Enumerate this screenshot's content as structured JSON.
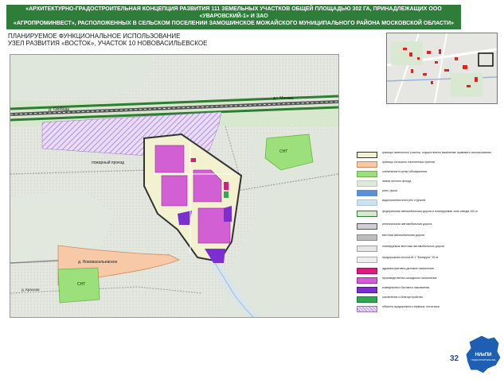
{
  "header": {
    "title": "«АРХИТЕКТУРНО-ГРАДОСТРОИТЕЛЬНАЯ КОНЦЕПЦИЯ РАЗВИТИЯ 111 ЗЕМЕЛЬНЫХ УЧАСТКОВ ОБЩЕЙ ПЛОЩАДЬЮ 302 ГА, ПРИНАДЛЕЖАЩИХ ООО «УВАРОВСКИЙ-1» И ЗАО\n«АГРОПРОМИНВЕСТ», РАСПОЛОЖЕННЫХ В СЕЛЬСКОМ ПОСЕЛЕНИИ ЗАМОШИНСКОЕ МОЖАЙСКОГО МУНИЦИПАЛЬНОГО РАЙОНА МОСКОВСКОЙ ОБЛАСТИ»"
  },
  "subtitle": "ПЛАНИРУЕМОЕ ФУНКЦИОНАЛЬНОЕ ИСПОЛЬЗОВАНИЕ\nУЗЕЛ РАЗВИТИЯ «ВОСТОК», УЧАСТОК 10 НОВОВАСИЛЬЕВСКОЕ",
  "map": {
    "labels": {
      "svoboda": "д. Свобода",
      "moscow": "д.г. Москва",
      "proezd": "пожарный проезд",
      "novovasilyevskoe": "д. Нововасильевское",
      "snt_east": "СНТ",
      "snt_west": "СНТ",
      "krasnaya": "д. Красная"
    }
  },
  "legend": [
    {
      "label": "границы земельного участка, осуществлено изменение правового использования",
      "color": "#f2f2d0",
      "border": "#333333"
    },
    {
      "label": "границы сельского населенных пунктов",
      "color": "#f7c9a6",
      "border": "#d08a55"
    },
    {
      "label": "озеленение в целях объединения",
      "color": "#9be07a",
      "border": "#6bb34a"
    },
    {
      "label": "земли лесного фонда",
      "color": "#dde9dd",
      "border": "#b9cbb9"
    },
    {
      "label": "реки, ручьи",
      "color": "#5a8fd6",
      "border": "#5a8fd6"
    },
    {
      "label": "водоохранная зона рек и ручьев",
      "color": "#cfe0f3",
      "border": "#a9c4e6"
    },
    {
      "label": "федеральная автомобильная дорога и планируемая зона отвода 100 м",
      "color": "#d8e8cf",
      "border": "#2e7d32"
    },
    {
      "label": "региональная автомобильная дорога",
      "color": "#cfcfcf",
      "border": "#555555"
    },
    {
      "label": "местная автомобильная дорога",
      "color": "#bdbdbd",
      "border": "#888888"
    },
    {
      "label": "планируемые местные автомобильные дороги",
      "color": "#e6e6e6",
      "border": "#9e9e9e"
    },
    {
      "label": "придорожная полоса М-1 \"Беларусь\" 50 м",
      "color": "#eeeeee",
      "border": "#aaaaaa"
    },
    {
      "label": "административно-деловое назначение",
      "color": "#e0197d",
      "border": "#a0105a"
    },
    {
      "label": "производственно-складского назначения",
      "color": "#d35fd5",
      "border": "#9a2f9c"
    },
    {
      "label": "коммунально-бытового назначения",
      "color": "#7b2fd1",
      "border": "#4e1a8f"
    },
    {
      "label": "озеленение и благоустройство",
      "color": "#2fa84f",
      "border": "#1c7a36"
    },
    {
      "label": "объекты придорожного сервиса, логистика",
      "color": "#c9a6e6",
      "border": "#9b77c2"
    }
  ],
  "page_number": "32",
  "emblem": {
    "line1": "НИиПИ",
    "line2": "ГРАДОСТРОИТЕЛЬСТВА"
  },
  "colors": {
    "header_bg": "#2f7d3a",
    "production": "#d35fd5",
    "admin": "#e0197d",
    "utility": "#7b2fd1",
    "greenery": "#9be07a",
    "settlement": "#f7c9a6",
    "hatch": "#b48be0"
  }
}
